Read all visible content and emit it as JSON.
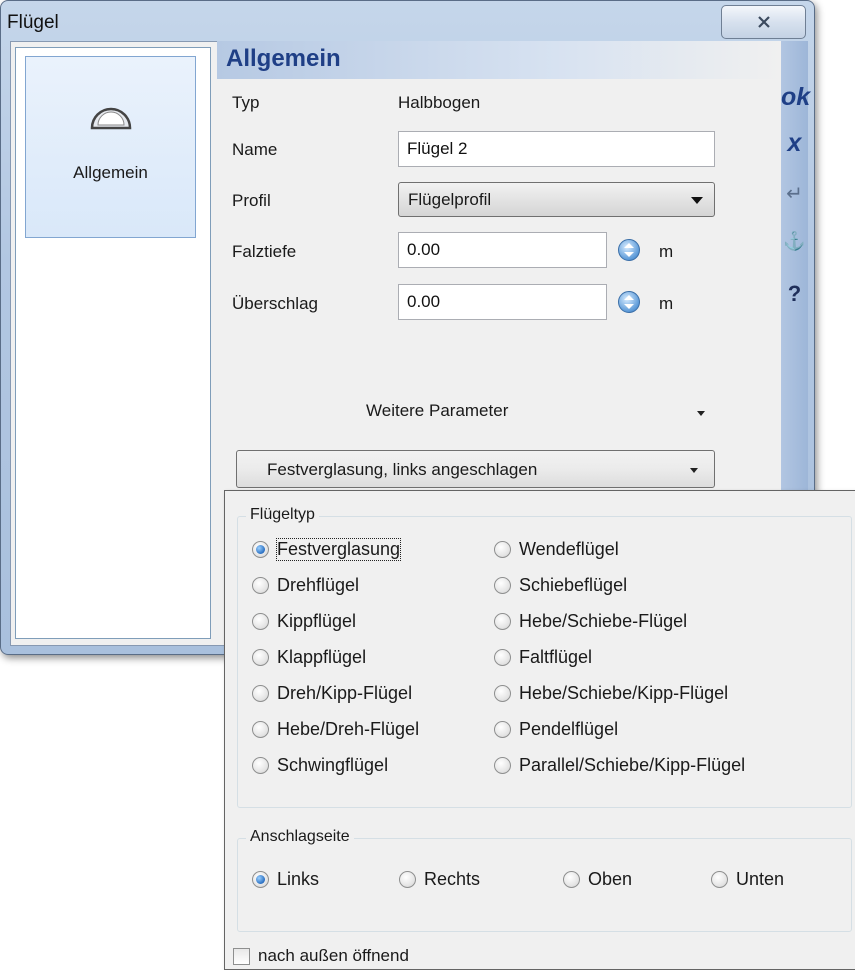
{
  "window": {
    "title": "Flügel"
  },
  "nav": {
    "items": [
      {
        "label": "Allgemein",
        "icon": "half-arch-icon"
      }
    ]
  },
  "panel": {
    "title": "Allgemein",
    "fields": {
      "typ": {
        "label": "Typ",
        "value": "Halbbogen"
      },
      "name": {
        "label": "Name",
        "value": "Flügel 2"
      },
      "profil": {
        "label": "Profil",
        "value": "Flügelprofil"
      },
      "falztiefe": {
        "label": "Falztiefe",
        "value": "0.00",
        "unit": "m"
      },
      "ueberschlag": {
        "label": "Überschlag",
        "value": "0.00",
        "unit": "m"
      }
    },
    "more_params": "Weitere Parameter",
    "type_selector": "Festverglasung, links angeschlagen"
  },
  "toolbar": {
    "ok": "ok",
    "cancel": "x",
    "enter": "↵",
    "pin": "⚓",
    "help": "?"
  },
  "popup": {
    "fluegeltyp": {
      "title": "Flügeltyp",
      "left": [
        "Festverglasung",
        "Drehflügel",
        "Kippflügel",
        "Klappflügel",
        "Dreh/Kipp-Flügel",
        "Hebe/Dreh-Flügel",
        "Schwingflügel"
      ],
      "right": [
        "Wendeflügel",
        "Schiebeflügel",
        "Hebe/Schiebe-Flügel",
        "Faltflügel",
        "Hebe/Schiebe/Kipp-Flügel",
        "Pendelflügel",
        "Parallel/Schiebe/Kipp-Flügel"
      ],
      "selected": "Festverglasung"
    },
    "anschlagseite": {
      "title": "Anschlagseite",
      "options": [
        "Links",
        "Rechts",
        "Oben",
        "Unten"
      ],
      "selected": "Links"
    },
    "open_outward": {
      "label": "nach außen öffnend",
      "checked": false
    }
  },
  "colors": {
    "accent": "#1f3f86",
    "selection_blue": "#2a6fc2",
    "title_gradient": "#b6c9e3"
  }
}
